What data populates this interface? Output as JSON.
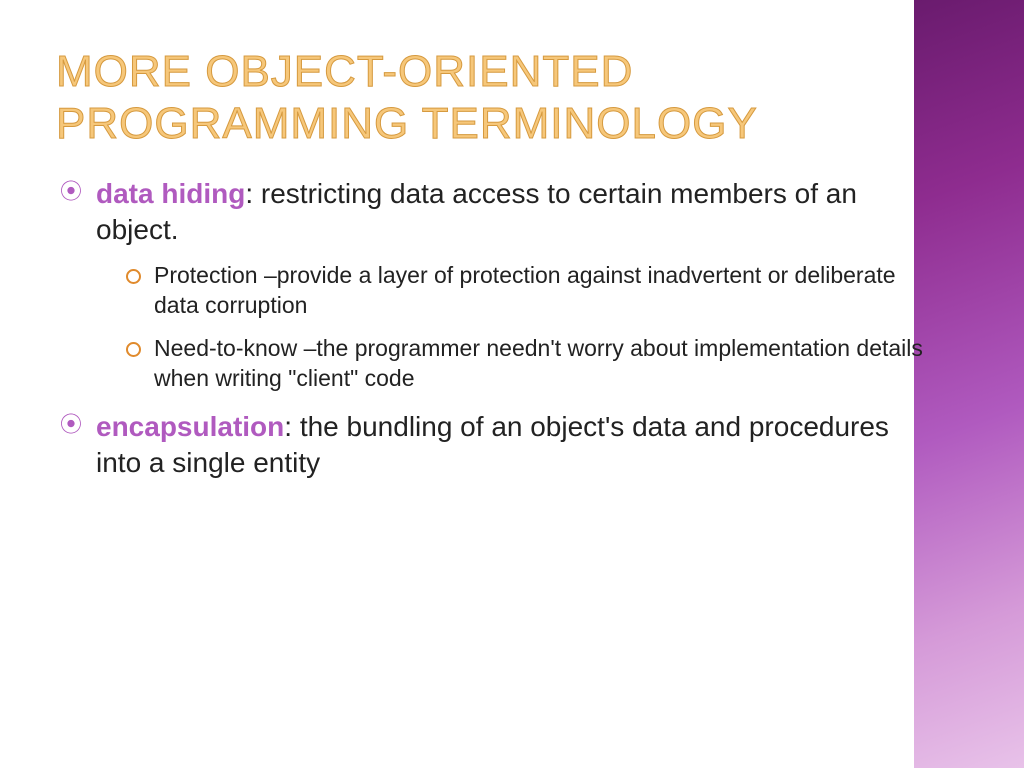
{
  "title": "More Object-Oriented Programming Terminology",
  "bullets": [
    {
      "term": "data hiding",
      "definition": ": restricting data access to certain members of an object.",
      "subs": [
        "Protection –provide a layer of protection against inadvertent or deliberate data corruption",
        "Need-to-know –the programmer needn't worry about implementation details when writing \"client\" code"
      ]
    },
    {
      "term": "encapsulation",
      "definition": ": the bundling of an object's data and procedures into a single entity",
      "subs": []
    }
  ]
}
